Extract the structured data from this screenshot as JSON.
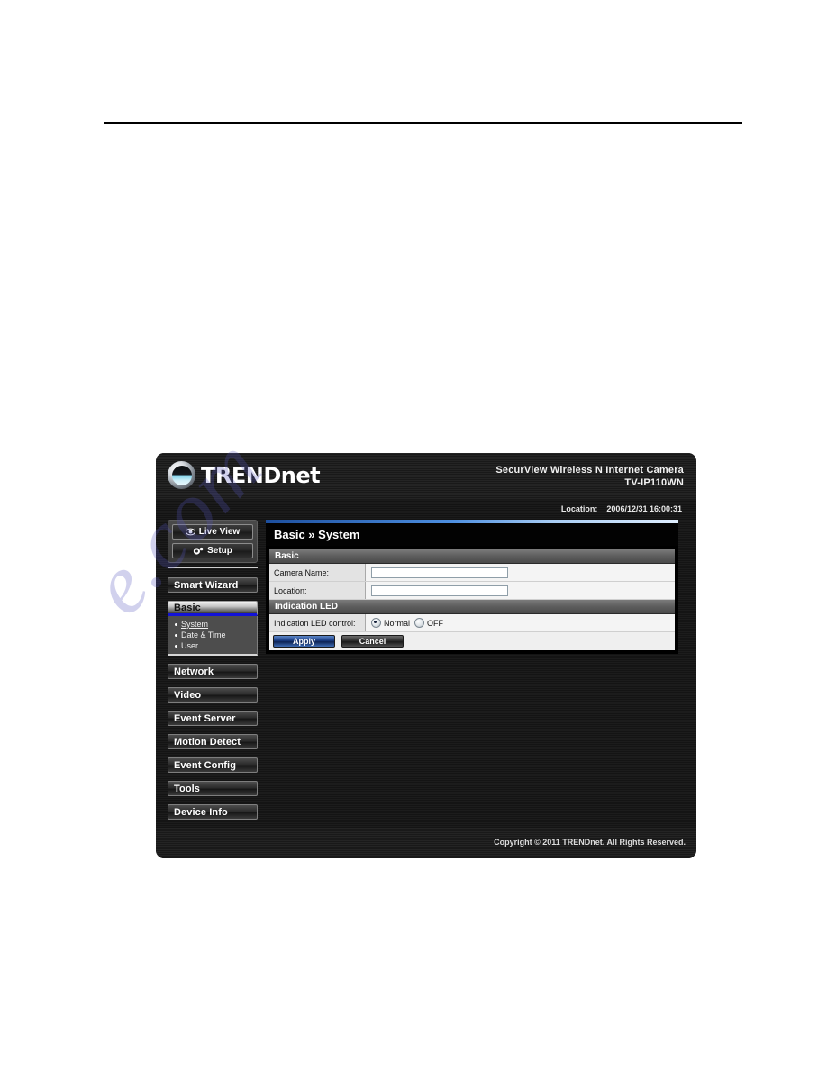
{
  "document": {
    "rule": "horizontal-rule"
  },
  "watermark": {
    "text": "e.com"
  },
  "device_ui": {
    "banner": {
      "logo_upper": "TREND",
      "logo_lower": "net",
      "product_line1": "SecurView Wireless N Internet Camera",
      "product_line2": "TV-IP110WN"
    },
    "location_bar": {
      "label": "Location:",
      "value": "2006/12/31 16:00:31"
    },
    "sidebar": {
      "view_buttons": [
        {
          "label": "Live View",
          "icon": "eye-icon"
        },
        {
          "label": "Setup",
          "icon": "gear-icon"
        }
      ],
      "nav_items": [
        {
          "label": "Smart Wizard",
          "active": false
        },
        {
          "label": "Basic",
          "active": true
        },
        {
          "label": "Network",
          "active": false
        },
        {
          "label": "Video",
          "active": false
        },
        {
          "label": "Event Server",
          "active": false
        },
        {
          "label": "Motion Detect",
          "active": false
        },
        {
          "label": "Event Config",
          "active": false
        },
        {
          "label": "Tools",
          "active": false
        },
        {
          "label": "Device Info",
          "active": false
        }
      ],
      "sub_items": [
        {
          "label": "System",
          "active": true
        },
        {
          "label": "Date & Time",
          "active": false
        },
        {
          "label": "User",
          "active": false
        }
      ]
    },
    "content": {
      "title": "Basic » System",
      "sections": [
        {
          "heading": "Basic",
          "rows": [
            {
              "label": "Camera Name:",
              "type": "text",
              "value": "",
              "placeholder": ""
            },
            {
              "label": "Location:",
              "type": "text",
              "value": "",
              "placeholder": ""
            }
          ]
        },
        {
          "heading": "Indication LED",
          "rows": [
            {
              "label": "Indication LED control:",
              "type": "radio",
              "options": [
                {
                  "label": "Normal",
                  "selected": true
                },
                {
                  "label": "OFF",
                  "selected": false
                }
              ]
            }
          ]
        }
      ],
      "buttons": [
        {
          "label": "Apply",
          "style": "primary"
        },
        {
          "label": "Cancel",
          "style": "secondary"
        }
      ]
    },
    "footer": {
      "copyright": "Copyright © 2011 TRENDnet. All Rights Reserved."
    }
  },
  "colors": {
    "accent_blue": "#1212d8",
    "banner_bg": "#1c1c1c",
    "panel_bg": "#000000",
    "field_label_bg": "#e3e3e3"
  }
}
